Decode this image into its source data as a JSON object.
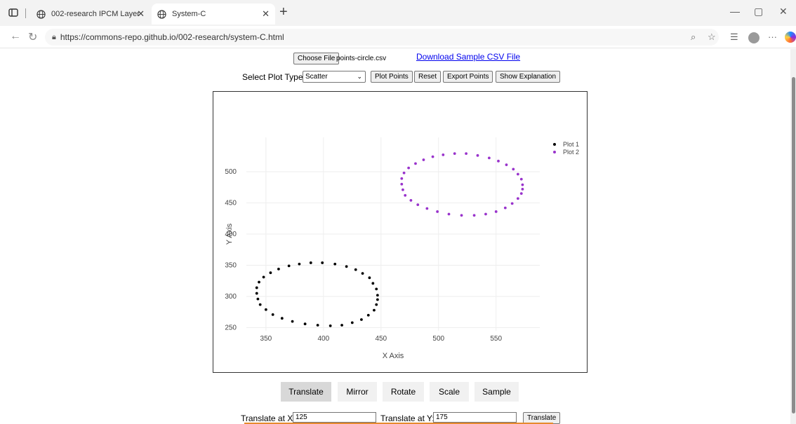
{
  "browser": {
    "tabs": [
      {
        "title": "002-research IPCM Layer"
      },
      {
        "title": "System-C"
      }
    ],
    "url": "https://commons-repo.github.io/002-research/system-C.html"
  },
  "controls": {
    "choose_file_label": "Choose File",
    "file_name": "points-circle.csv",
    "download_link": "Download Sample CSV File",
    "plot_type_label": "Select Plot Type:",
    "plot_type_value": "Scatter",
    "plot_points_button": "Plot Points",
    "reset_button": "Reset",
    "export_button": "Export Points",
    "explanation_button": "Show Explanation"
  },
  "transform_tabs": [
    "Translate",
    "Mirror",
    "Rotate",
    "Scale",
    "Sample"
  ],
  "active_tab": "Translate",
  "translate": {
    "x_label": "Translate at X:",
    "x_value": "125",
    "y_label": "Translate at Y:",
    "y_value": "175",
    "button": "Translate"
  },
  "chart_data": {
    "type": "scatter",
    "xlabel": "X Axis",
    "ylabel": "Y Axis",
    "xlim": [
      333,
      588
    ],
    "ylim": [
      245,
      555
    ],
    "xticks": [
      350,
      400,
      450,
      500,
      550
    ],
    "yticks": [
      250,
      300,
      350,
      400,
      450,
      500
    ],
    "grid": true,
    "legend_position": "top-right",
    "series": [
      {
        "name": "Plot 1",
        "color": "#000000",
        "points": [
          [
            447,
            302
          ],
          [
            446,
            312
          ],
          [
            443,
            321
          ],
          [
            440,
            330
          ],
          [
            434,
            337
          ],
          [
            428,
            343
          ],
          [
            420,
            348
          ],
          [
            410,
            352
          ],
          [
            399,
            354
          ],
          [
            389,
            354
          ],
          [
            379,
            352
          ],
          [
            370,
            349
          ],
          [
            361,
            344
          ],
          [
            354,
            338
          ],
          [
            348,
            331
          ],
          [
            344,
            323
          ],
          [
            342,
            314
          ],
          [
            342,
            305
          ],
          [
            343,
            296
          ],
          [
            345,
            287
          ],
          [
            350,
            279
          ],
          [
            356,
            271
          ],
          [
            364,
            265
          ],
          [
            373,
            260
          ],
          [
            384,
            256
          ],
          [
            395,
            254
          ],
          [
            406,
            253
          ],
          [
            416,
            254
          ],
          [
            425,
            258
          ],
          [
            433,
            263
          ],
          [
            439,
            270
          ],
          [
            444,
            278
          ],
          [
            446,
            287
          ],
          [
            447,
            295
          ]
        ]
      },
      {
        "name": "Plot 2",
        "color": "#9933cc",
        "points": [
          [
            573,
            479
          ],
          [
            572,
            488
          ],
          [
            569,
            496
          ],
          [
            565,
            504
          ],
          [
            559,
            511
          ],
          [
            552,
            517
          ],
          [
            544,
            522
          ],
          [
            534,
            526
          ],
          [
            524,
            529
          ],
          [
            514,
            529
          ],
          [
            504,
            527
          ],
          [
            495,
            524
          ],
          [
            487,
            519
          ],
          [
            480,
            513
          ],
          [
            474,
            506
          ],
          [
            470,
            498
          ],
          [
            468,
            489
          ],
          [
            468,
            480
          ],
          [
            469,
            471
          ],
          [
            471,
            462
          ],
          [
            476,
            454
          ],
          [
            482,
            447
          ],
          [
            490,
            441
          ],
          [
            499,
            436
          ],
          [
            509,
            432
          ],
          [
            520,
            430
          ],
          [
            531,
            430
          ],
          [
            541,
            432
          ],
          [
            550,
            436
          ],
          [
            558,
            442
          ],
          [
            564,
            449
          ],
          [
            569,
            457
          ],
          [
            572,
            465
          ],
          [
            573,
            472
          ]
        ]
      }
    ]
  }
}
